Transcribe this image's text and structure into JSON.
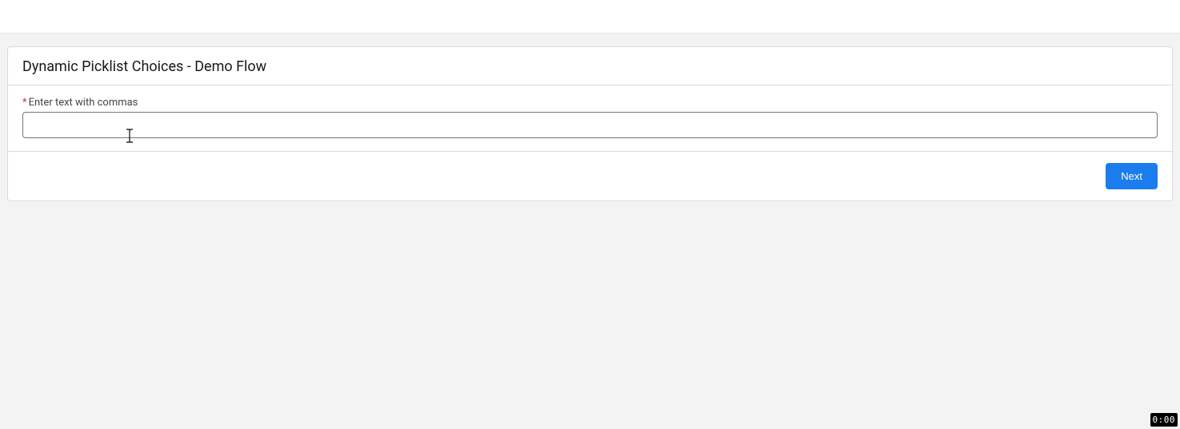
{
  "header": {
    "title": "Dynamic Picklist Choices - Demo Flow"
  },
  "form": {
    "required_marker": "*",
    "label": "Enter text with commas",
    "input_value": ""
  },
  "footer": {
    "next_label": "Next"
  },
  "overlay": {
    "time_badge": "0:00"
  }
}
